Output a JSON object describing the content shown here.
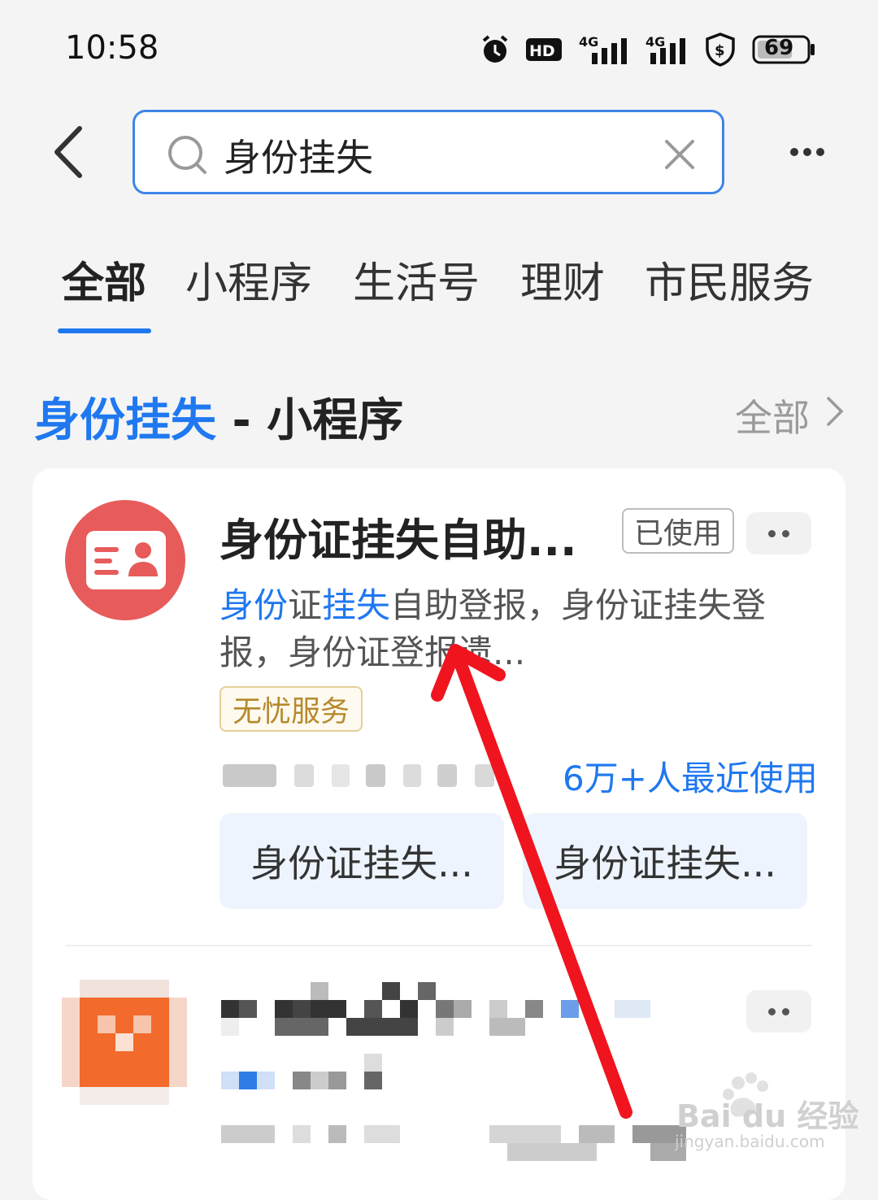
{
  "status_bar": {
    "time": "10:58",
    "battery": "69",
    "icons": [
      "alarm-icon",
      "hd-icon",
      "signal-4g-icon",
      "signal-4g-icon",
      "shield-icon",
      "battery-icon"
    ]
  },
  "header": {
    "search_value": "身份挂失"
  },
  "tabs": [
    {
      "label": "全部",
      "active": true
    },
    {
      "label": "小程序",
      "active": false
    },
    {
      "label": "生活号",
      "active": false
    },
    {
      "label": "理财",
      "active": false
    },
    {
      "label": "市民服务",
      "active": false
    }
  ],
  "section": {
    "title_highlight": "身份挂失",
    "title_rest": " - 小程序",
    "all_label": "全部"
  },
  "result1": {
    "name": "身份证挂失自助...",
    "used_badge": "已使用",
    "desc_part1": "身份",
    "desc_part2": "证",
    "desc_part3": "挂失",
    "desc_part4": "自助登报，身份证挂失登报，身份证登报遗...",
    "tag": "无忧服务",
    "usage": "6万+人最近使用",
    "services": [
      "身份证挂失...",
      "身份证挂失..."
    ]
  },
  "colors": {
    "accent": "#1f78f0",
    "icon_red": "#e85b5b",
    "arrow_red": "#f0141e"
  },
  "watermark": {
    "text": "Bai du 经验",
    "url": "jingyan.baidu.com"
  }
}
